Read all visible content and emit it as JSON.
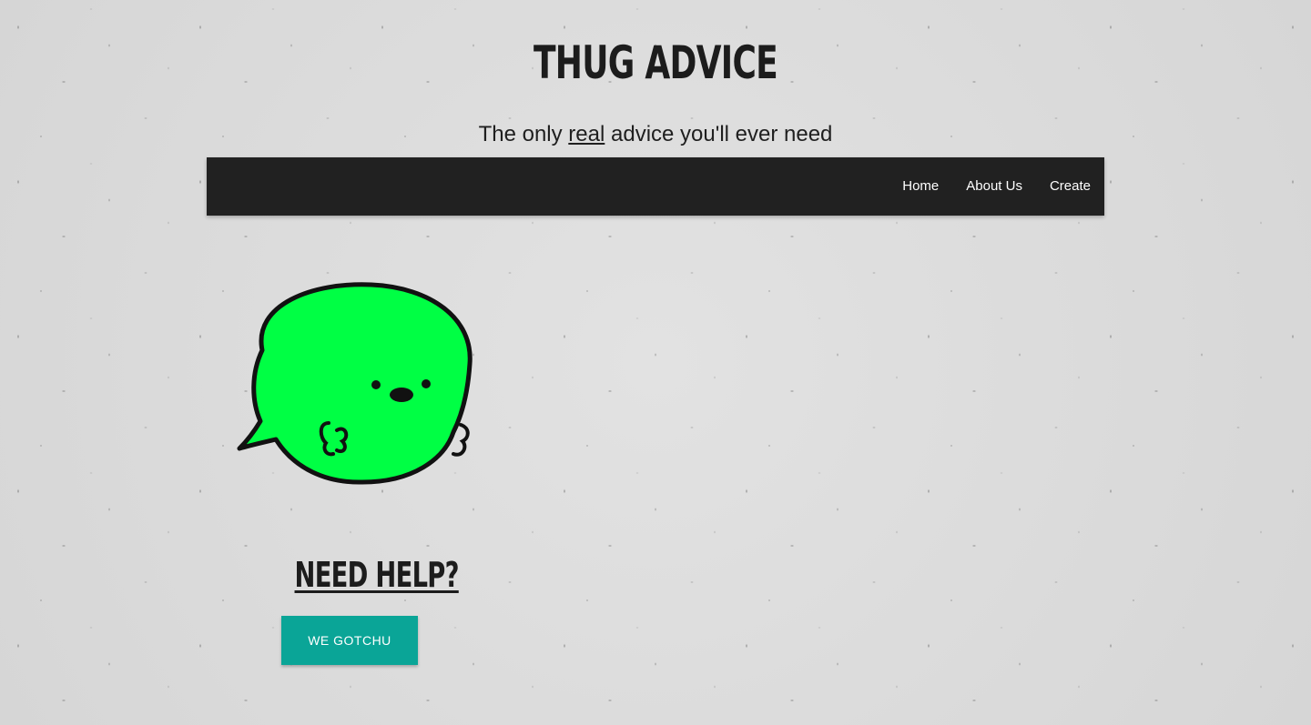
{
  "header": {
    "title": "THUG ADVICE",
    "tagline_before": "The only ",
    "tagline_emphasis": "real",
    "tagline_after": " advice you'll ever need"
  },
  "nav": {
    "items": [
      {
        "label": "Home"
      },
      {
        "label": "About Us"
      },
      {
        "label": "Create"
      }
    ]
  },
  "mascot": {
    "icon": "green-speech-bubble-mascot",
    "color": "#00ff44"
  },
  "help": {
    "heading": "NEED HELP?",
    "button_label": "WE GOTCHU"
  },
  "colors": {
    "navbar_bg": "#212121",
    "button_bg": "#0aa597",
    "text": "#1c1c1c"
  }
}
